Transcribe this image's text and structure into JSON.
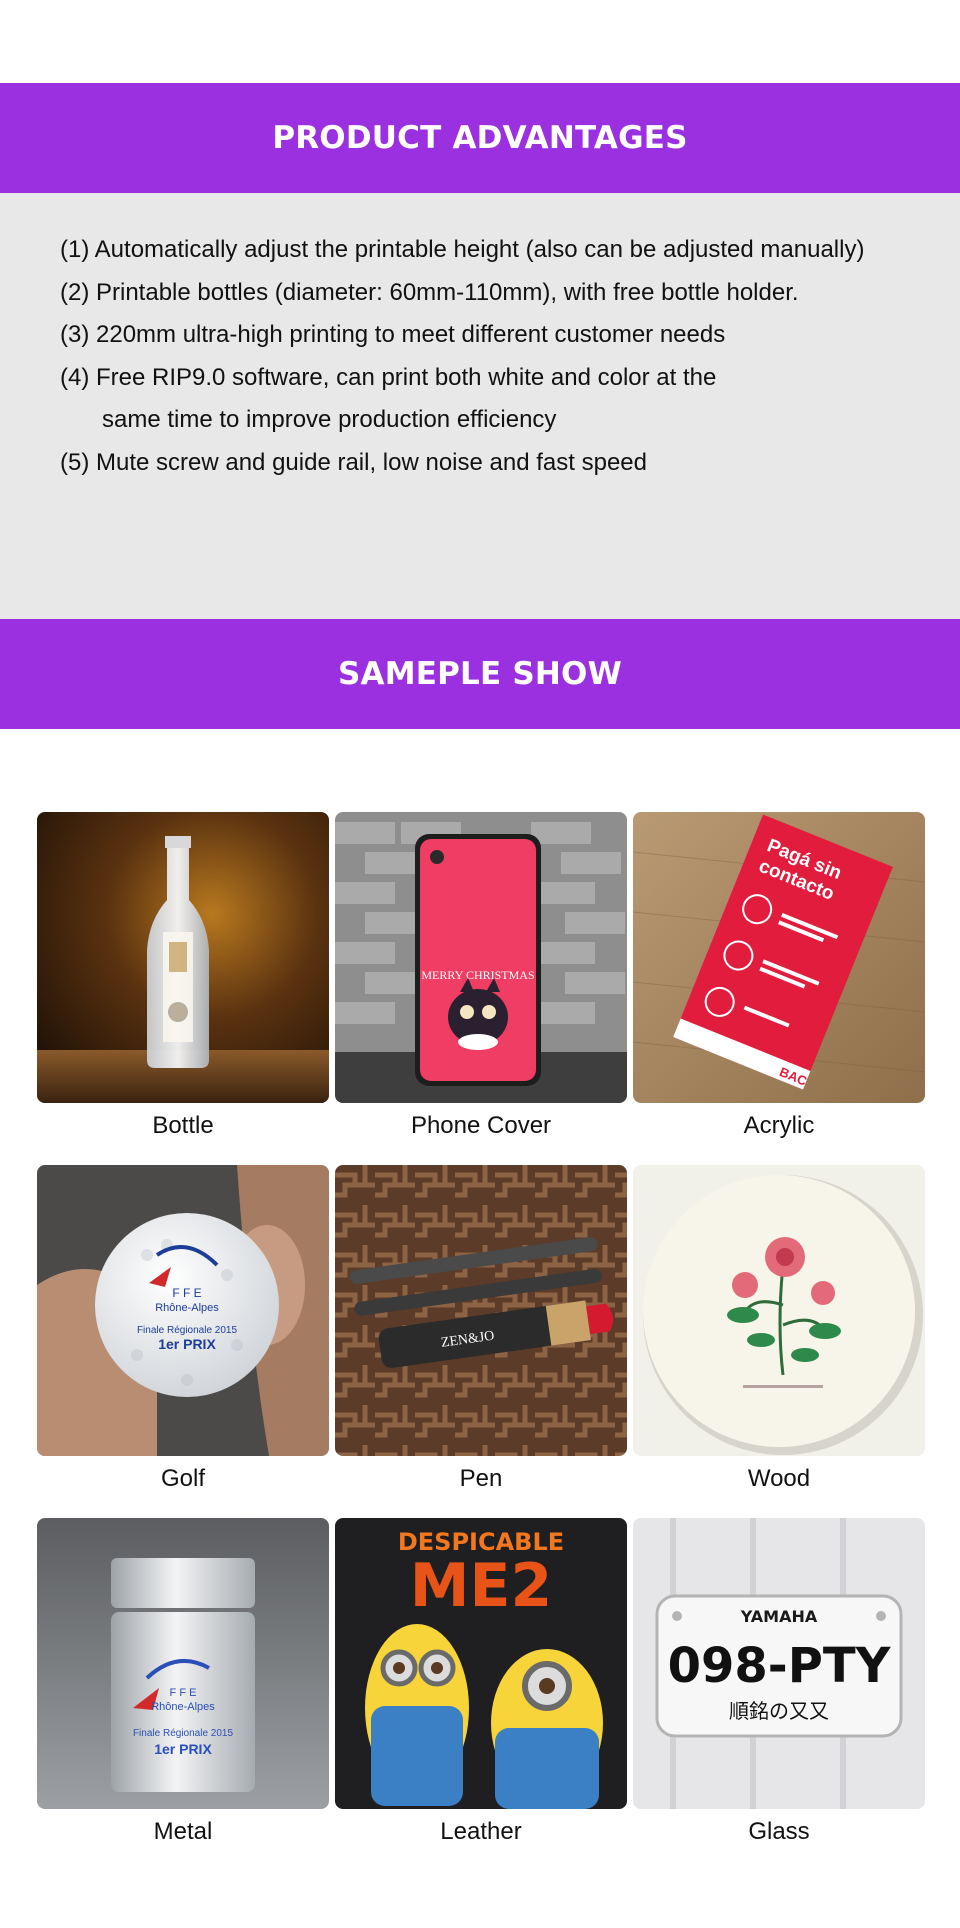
{
  "advantages": {
    "title": "PRODUCT ADVANTAGES",
    "items": [
      "(1) Automatically adjust the printable height (also can be adjusted manually)",
      "(2) Printable bottles (diameter: 60mm-110mm), with free bottle holder.",
      "(3) 220mm ultra-high printing to meet different customer needs",
      "(4) Free RIP9.0 software, can print both white and color at the",
      "same time to improve production efficiency",
      "(5) Mute screw and guide rail, low noise and fast speed"
    ]
  },
  "samples": {
    "title": "SAMEPLE SHOW",
    "items": [
      {
        "label": "Bottle"
      },
      {
        "label": "Phone Cover",
        "print_text": "MERRY CHRISTMAS"
      },
      {
        "label": "Acrylic",
        "print_text": [
          "Pagá sin",
          "contacto",
          "BAC"
        ]
      },
      {
        "label": "Golf",
        "print_text": [
          "F F E",
          "Rhône-Alpes",
          "Finale Régionale 2015",
          "1er PRIX"
        ]
      },
      {
        "label": "Pen",
        "print_text": "ZEN&JO"
      },
      {
        "label": "Wood"
      },
      {
        "label": "Metal",
        "print_text": [
          "F F E",
          "Rhône-Alpes",
          "Finale Régionale 2015",
          "1er PRIX"
        ]
      },
      {
        "label": "Leather",
        "print_text": [
          "DESPICABLE",
          "ME2"
        ]
      },
      {
        "label": "Glass",
        "print_text": [
          "YAMAHA",
          "098-PTY",
          "順銘の又又"
        ]
      }
    ]
  },
  "colors": {
    "banner": "#9b30e0",
    "panel": "#e8e8e8"
  }
}
